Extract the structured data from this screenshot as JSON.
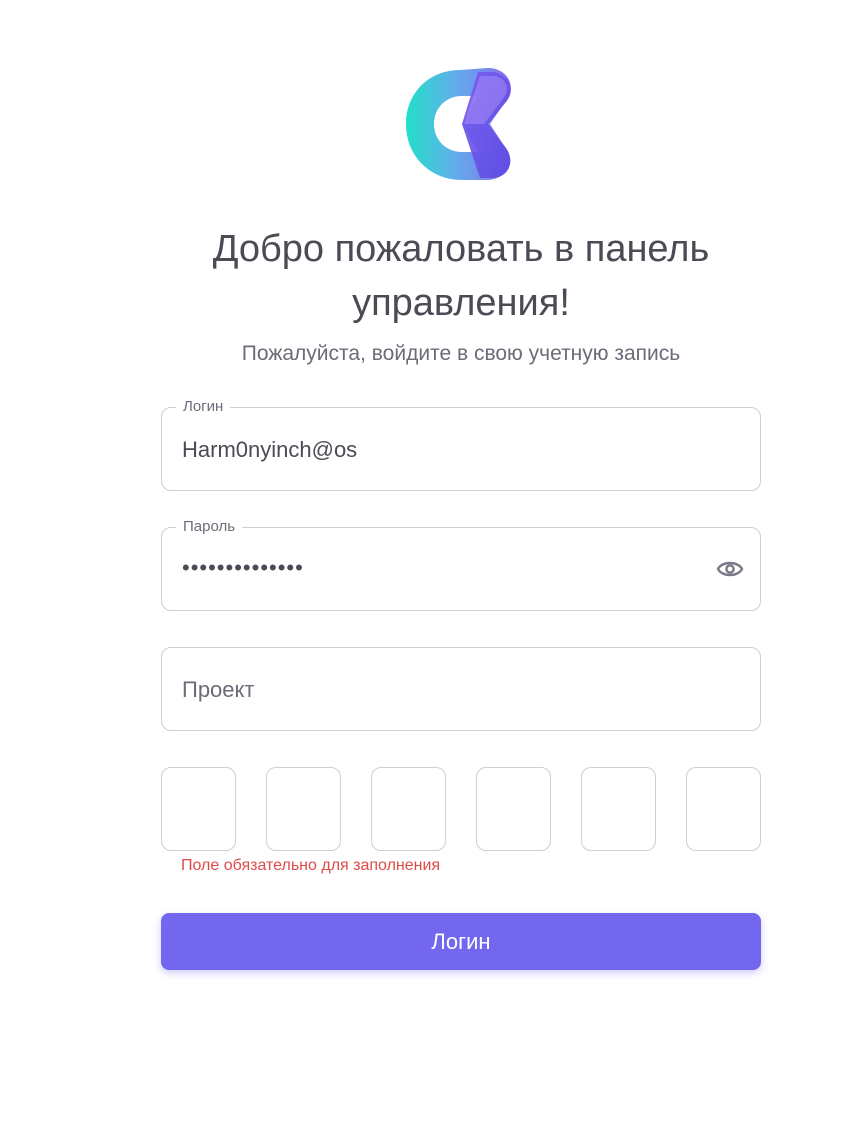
{
  "app": {
    "logo_icon": "brand-logo-icon"
  },
  "header": {
    "title": "Добро пожаловать в панель управления!",
    "subtitle": "Пожалуйста, войдите в свою учетную запись"
  },
  "form": {
    "login": {
      "label": "Логин",
      "value": "Harm0nyinch@os"
    },
    "password": {
      "label": "Пароль",
      "value": "••••••••••••••",
      "toggle_icon": "eye-icon"
    },
    "project": {
      "placeholder": "Проект",
      "value": ""
    },
    "code": {
      "digits": [
        "",
        "",
        "",
        "",
        "",
        ""
      ],
      "error": "Поле обязательно для заполнения"
    },
    "submit_label": "Логин"
  },
  "colors": {
    "accent": "#7367f0",
    "error": "#e04a4a",
    "text": "#4b4b55",
    "muted": "#6d6b77",
    "border": "#cfcfd4"
  }
}
